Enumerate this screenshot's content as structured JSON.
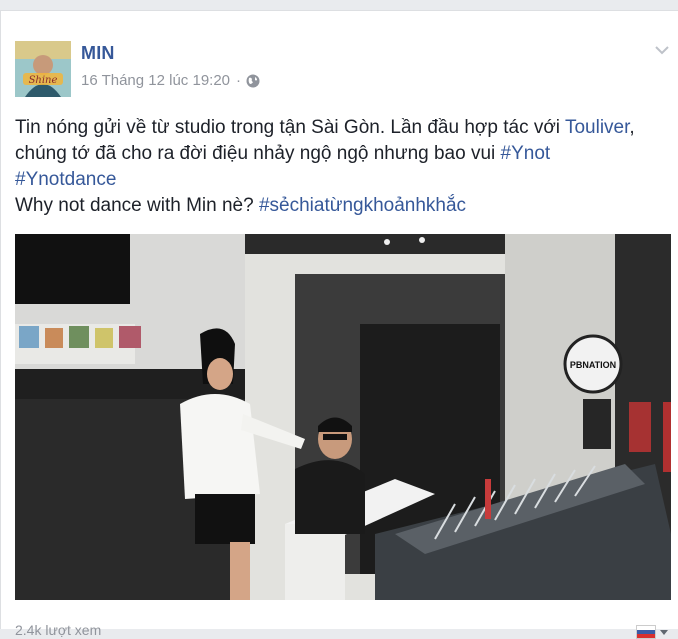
{
  "post": {
    "author": "MIN",
    "timestamp": "16 Tháng 12 lúc 19:20",
    "separator": "·",
    "privacy_icon": "globe-icon",
    "menu_icon": "chevron-down-icon",
    "avatar_text": "Shine"
  },
  "body": {
    "line1_a": "Tin nóng gửi về từ studio trong tận Sài Gòn. Lần đầu hợp tác với ",
    "line1_link": "Touliver",
    "line1_b": ",",
    "line2_a": "chúng tớ đã cho ra đời điệu nhảy ngộ ngộ nhưng bao vui ",
    "tag_ynot": "#Ynot",
    "tag_ynotdance": "#Ynotdance",
    "line4_a": "Why not dance with Min nè? ",
    "tag_share": "#sẻchiatừngkhoảnhkhắc"
  },
  "video": {
    "sign_text": "PBNATION"
  },
  "footer": {
    "views": "2.4k lượt xem",
    "language_icon": "flag-icon"
  },
  "colors": {
    "link": "#365899",
    "meta": "#90949c",
    "text": "#1d2129"
  }
}
